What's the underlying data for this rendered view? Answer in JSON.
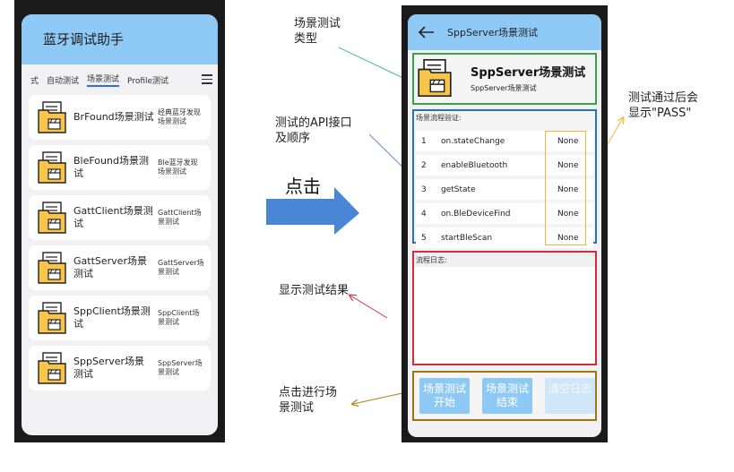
{
  "left": {
    "app_title": "蓝牙调试助手",
    "tabs": [
      {
        "label": "式",
        "active": false
      },
      {
        "label": "自动测试",
        "active": false
      },
      {
        "label": "场景测试",
        "active": true
      },
      {
        "label": "Profile测试",
        "active": false
      }
    ],
    "cards": [
      {
        "title": "BrFound场景测试",
        "desc": "经典蓝牙发现场景测试"
      },
      {
        "title": "BleFound场景测试",
        "desc": "Ble蓝牙发现场景测试"
      },
      {
        "title": "GattClient场景测试",
        "desc": "GattClient场景测试"
      },
      {
        "title": "GattServer场景测试",
        "desc": "GattServer场景测试"
      },
      {
        "title": "SppClient场景测试",
        "desc": "SppClient场景测试"
      },
      {
        "title": "SppServer场景测试",
        "desc": "SppServer场景测试"
      }
    ]
  },
  "annotations": {
    "scene_type": "场景测试\n类型",
    "api_order": "测试的API接口\n及顺序",
    "click": "点击",
    "show_result": "显示测试结果",
    "run_test": "点击进行场\n景测试",
    "pass_note": "测试通过后会\n显示\"PASS\""
  },
  "right": {
    "app_title": "SppServer场景测试",
    "header_title": "SppServer场景测试",
    "header_subtitle": "SppServer场景测试",
    "steps_label": "场景流程验证:",
    "steps": [
      {
        "n": "1",
        "api": "on.stateChange",
        "result": "None"
      },
      {
        "n": "2",
        "api": "enableBluetooth",
        "result": "None"
      },
      {
        "n": "3",
        "api": "getState",
        "result": "None"
      },
      {
        "n": "4",
        "api": "on.BleDeviceFind",
        "result": "None"
      },
      {
        "n": "5",
        "api": "startBleScan",
        "result": "None"
      }
    ],
    "log_label": "流程日志:",
    "buttons": [
      {
        "label": "场景测试开始",
        "disabled": false
      },
      {
        "label": "场景测试结束",
        "disabled": false
      },
      {
        "label": "清空日志",
        "disabled": true
      }
    ]
  },
  "colors": {
    "appbar": "#8ec9f5",
    "header_border": "#3aa24e",
    "steps_border": "#2c72b0",
    "pass_border": "#f2b431",
    "log_border": "#d22d3f",
    "btn_border": "#a07414",
    "big_arrow": "#4a86d6"
  }
}
